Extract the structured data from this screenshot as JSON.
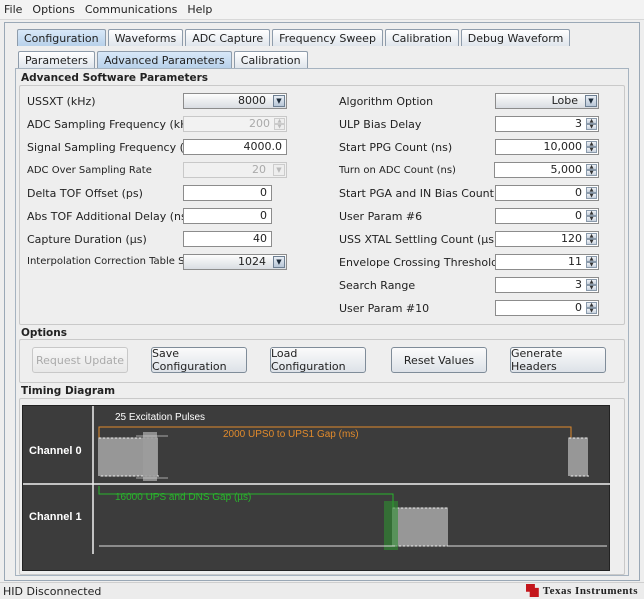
{
  "menu": [
    "File",
    "Options",
    "Communications",
    "Help"
  ],
  "top_tabs": [
    "Configuration",
    "Waveforms",
    "ADC Capture",
    "Frequency Sweep",
    "Calibration",
    "Debug Waveform"
  ],
  "sub_tabs": [
    "Parameters",
    "Advanced Parameters",
    "Calibration"
  ],
  "advanced_title": "Advanced Software Parameters",
  "left_params": [
    {
      "label": "USSXT (kHz)",
      "value": "8000"
    },
    {
      "label": "ADC Sampling Frequency (kHz)",
      "value": "200"
    },
    {
      "label": "Signal Sampling Frequency (kHz)",
      "value": "4000.0"
    },
    {
      "label": "ADC Over Sampling Rate",
      "value": "20"
    },
    {
      "label": "Delta TOF Offset (ps)",
      "value": "0"
    },
    {
      "label": "Abs TOF Additional Delay (ns)",
      "value": "0"
    },
    {
      "label": "Capture Duration (µs)",
      "value": "40"
    },
    {
      "label": "Interpolation Correction Table Size",
      "value": "1024"
    }
  ],
  "right_params": [
    {
      "label": "Algorithm Option",
      "value": "Lobe"
    },
    {
      "label": "ULP Bias Delay",
      "value": "3"
    },
    {
      "label": "Start PPG Count (ns)",
      "value": "10,000"
    },
    {
      "label": "Turn on ADC Count (ns)",
      "value": "5,000"
    },
    {
      "label": "Start PGA and IN Bias Count (ns)",
      "value": "0"
    },
    {
      "label": "User Param #6",
      "value": "0"
    },
    {
      "label": "USS XTAL Settling Count (µs)",
      "value": "120"
    },
    {
      "label": "Envelope Crossing Threshold",
      "value": "11"
    },
    {
      "label": "Search Range",
      "value": "3"
    },
    {
      "label": "User Param #10",
      "value": "0"
    }
  ],
  "options_title": "Options",
  "buttons": [
    "Request Update",
    "Save Configuration",
    "Load Configuration",
    "Reset Values",
    "Generate Headers"
  ],
  "timing_title": "Timing Diagram",
  "timing": {
    "channel0": "Channel 0",
    "channel1": "Channel 1",
    "excitation": "25 Excitation Pulses",
    "gap0": "2000 UPS0 to UPS1 Gap (ms)",
    "gap1": "16000 UPS and DNS Gap (µs)",
    "orange": "#e08a2c",
    "green": "#29b52c"
  },
  "status": "HID Disconnected",
  "logo_text": "Texas Instruments"
}
